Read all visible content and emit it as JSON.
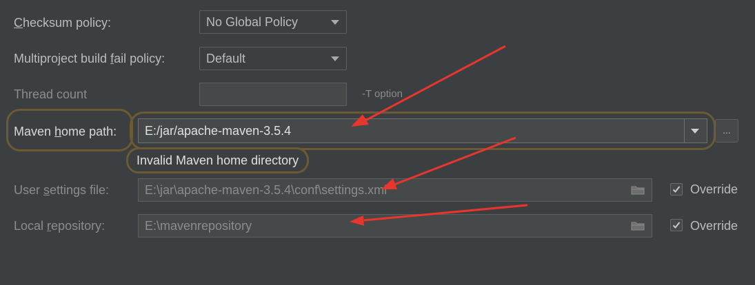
{
  "checksum": {
    "label_prefix": "",
    "label_mnemonic": "C",
    "label_rest": "hecksum policy:",
    "value": "No Global Policy"
  },
  "multiproject": {
    "label_before": "Multiproject build ",
    "label_mnemonic": "f",
    "label_after": "ail policy:",
    "value": "Default"
  },
  "thread": {
    "label": "Thread count",
    "value": "",
    "hint": "-T option"
  },
  "maven_home": {
    "label_before": "Maven ",
    "label_mnemonic": "h",
    "label_after": "ome path:",
    "value": "E:/jar/apache-maven-3.5.4",
    "browse_label": "...",
    "error": "Invalid Maven home directory"
  },
  "user_settings": {
    "label_before": "User ",
    "label_mnemonic": "s",
    "label_after": "ettings file:",
    "value": "E:\\jar\\apache-maven-3.5.4\\conf\\settings.xml",
    "override_label": "Override",
    "override_checked": true
  },
  "local_repo": {
    "label_before": "Local ",
    "label_mnemonic": "r",
    "label_after": "epository:",
    "value": "E:\\mavenrepository",
    "override_label": "Override",
    "override_checked": true
  },
  "colors": {
    "background": "#3c3f41",
    "highlight_outline": "#6b5a34",
    "annotation_arrow": "#e8352e"
  }
}
